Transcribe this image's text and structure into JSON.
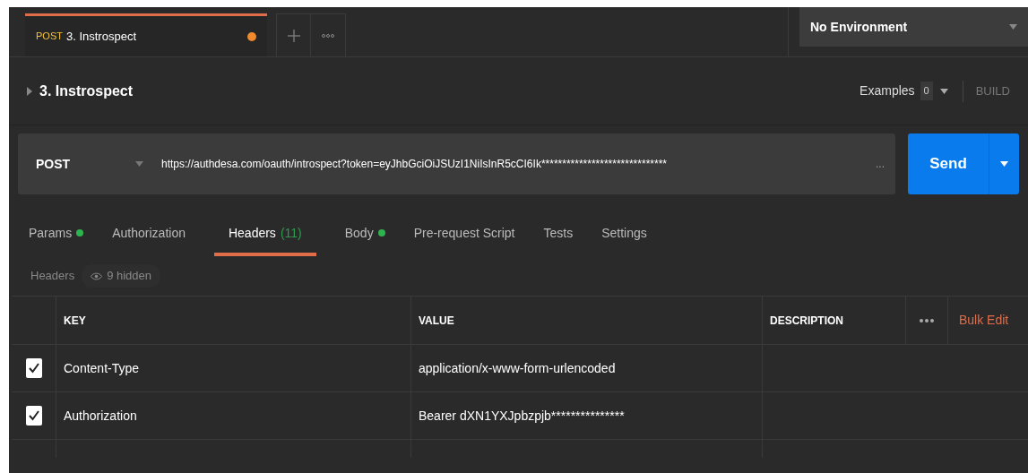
{
  "request_tabs": [
    {
      "method": "POST",
      "title": "3. Instrospect",
      "selected": true,
      "unsaved": true
    }
  ],
  "environment": {
    "value": "No Environment"
  },
  "request": {
    "name": "3. Instrospect",
    "expanded": false,
    "examples_label": "Examples",
    "examples_count": "0",
    "build_label": "BUILD"
  },
  "url_bar": {
    "method": "POST",
    "url": "https://authdesa.com/oauth/introspect?token=eyJhbGciOiJSUzI1NiIsInR5cCI6Ik******************************",
    "overflow": "...",
    "send_label": "Send"
  },
  "section_tabs": [
    {
      "label": "Params",
      "dot": true,
      "selected": false
    },
    {
      "label": "Authorization",
      "dot": false,
      "selected": false
    },
    {
      "label": "Headers",
      "count": "(11)",
      "dot": false,
      "selected": true
    },
    {
      "label": "Body",
      "dot": true,
      "selected": false
    },
    {
      "label": "Pre-request Script",
      "dot": false,
      "selected": false
    },
    {
      "label": "Tests",
      "dot": false,
      "selected": false
    },
    {
      "label": "Settings",
      "dot": false,
      "selected": false
    }
  ],
  "headers_bar": {
    "label": "Headers",
    "hidden": "9 hidden"
  },
  "table": {
    "columns": [
      "KEY",
      "VALUE",
      "DESCRIPTION"
    ],
    "bulk_edit": "Bulk Edit",
    "rows": [
      {
        "checked": true,
        "key": "Content-Type",
        "value": "application/x-www-form-urlencoded"
      },
      {
        "checked": true,
        "key": "Authorization",
        "value": "Bearer dXN1YXJpbzpjb***************"
      }
    ]
  }
}
